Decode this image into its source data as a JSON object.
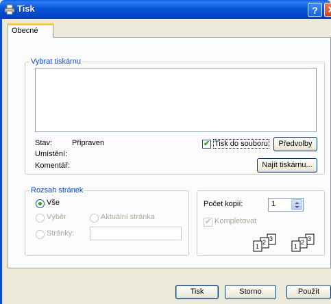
{
  "window": {
    "title": "Tisk",
    "help": "?",
    "close": "✕"
  },
  "tabs": [
    {
      "label": "Obecné"
    }
  ],
  "printer_group": {
    "legend": "Vybrat tiskárnu",
    "status_label": "Stav:",
    "status_value": "Připraven",
    "location_label": "Umístění:",
    "comment_label": "Komentář:",
    "print_to_file_label": "Tisk do souboru",
    "print_to_file_checked": true,
    "preferences_button": "Předvolby",
    "find_printer_button": "Najít tiskárnu..."
  },
  "page_range": {
    "legend": "Rozsah stránek",
    "all_label": "Vše",
    "selection_label": "Výběr",
    "current_page_label": "Aktuální stránka",
    "pages_label": "Stránky:",
    "pages_value": ""
  },
  "copies": {
    "count_label": "Počet kopií:",
    "count_value": "1",
    "collate_label": "Kompletovat",
    "collate_checked": true,
    "collate_pages": [
      "1",
      "2",
      "3"
    ]
  },
  "footer": {
    "print_button": "Tisk",
    "cancel_button": "Storno",
    "apply_button": "Použít"
  },
  "icons": {
    "title": "printer-icon",
    "spin": "spinner-arrows-icon",
    "collate": "collate-pages-icon"
  }
}
